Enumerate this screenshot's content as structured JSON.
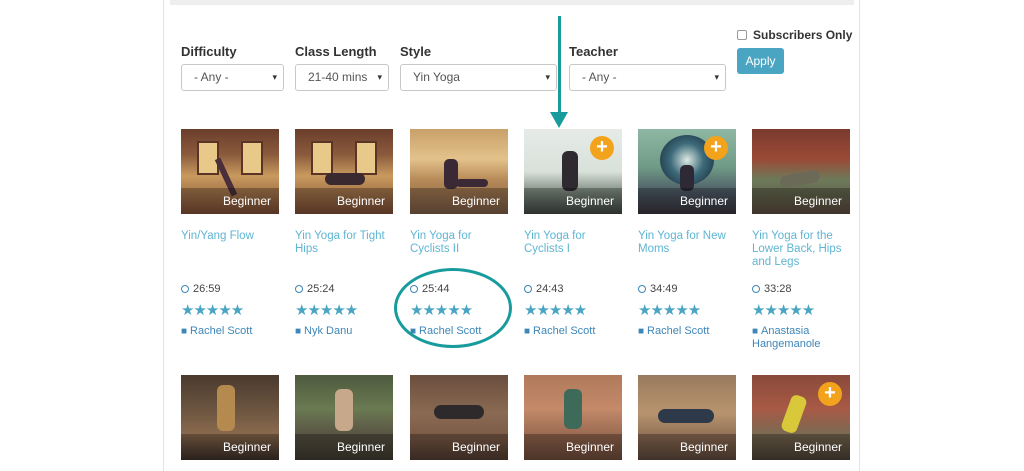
{
  "filters": {
    "difficulty": {
      "label": "Difficulty",
      "value": "- Any -"
    },
    "class_length": {
      "label": "Class Length",
      "value": "21-40 mins"
    },
    "style": {
      "label": "Style",
      "value": "Yin Yoga"
    },
    "teacher": {
      "label": "Teacher",
      "value": "- Any -"
    }
  },
  "subscribers_only": {
    "label": "Subscribers Only",
    "checked": false
  },
  "apply_label": "Apply",
  "icons": {
    "caret": "▾",
    "plus": "+",
    "person": "👤",
    "star": "★"
  },
  "colors": {
    "accent": "#4aa5c2",
    "title": "#5fb5d3",
    "highlight": "#179b9c",
    "add": "#f2a31b"
  },
  "cards": [
    {
      "level": "Beginner",
      "title": "Yin/Yang Flow",
      "duration": "26:59",
      "rating": 5,
      "teacher": "Rachel Scott",
      "addable": false
    },
    {
      "level": "Beginner",
      "title": "Yin Yoga for Tight Hips",
      "duration": "25:24",
      "rating": 5,
      "teacher": "Nyk Danu",
      "addable": false
    },
    {
      "level": "Beginner",
      "title": "Yin Yoga for Cyclists II",
      "duration": "25:44",
      "rating": 5,
      "teacher": "Rachel Scott",
      "addable": false
    },
    {
      "level": "Beginner",
      "title": "Yin Yoga for Cyclists I",
      "duration": "24:43",
      "rating": 5,
      "teacher": "Rachel Scott",
      "addable": true
    },
    {
      "level": "Beginner",
      "title": "Yin Yoga for New Moms",
      "duration": "34:49",
      "rating": 5,
      "teacher": "Rachel Scott",
      "addable": true
    },
    {
      "level": "Beginner",
      "title": "Yin Yoga for the Lower Back, Hips and Legs",
      "duration": "33:28",
      "rating": 5,
      "teacher": "Anastasia Hangemanole",
      "addable": false
    }
  ],
  "cards_row2": [
    {
      "level": "Beginner",
      "addable": false
    },
    {
      "level": "Beginner",
      "addable": false
    },
    {
      "level": "Beginner",
      "addable": false
    },
    {
      "level": "Beginner",
      "addable": false
    },
    {
      "level": "Beginner",
      "addable": false
    },
    {
      "level": "Beginner",
      "addable": true
    }
  ]
}
